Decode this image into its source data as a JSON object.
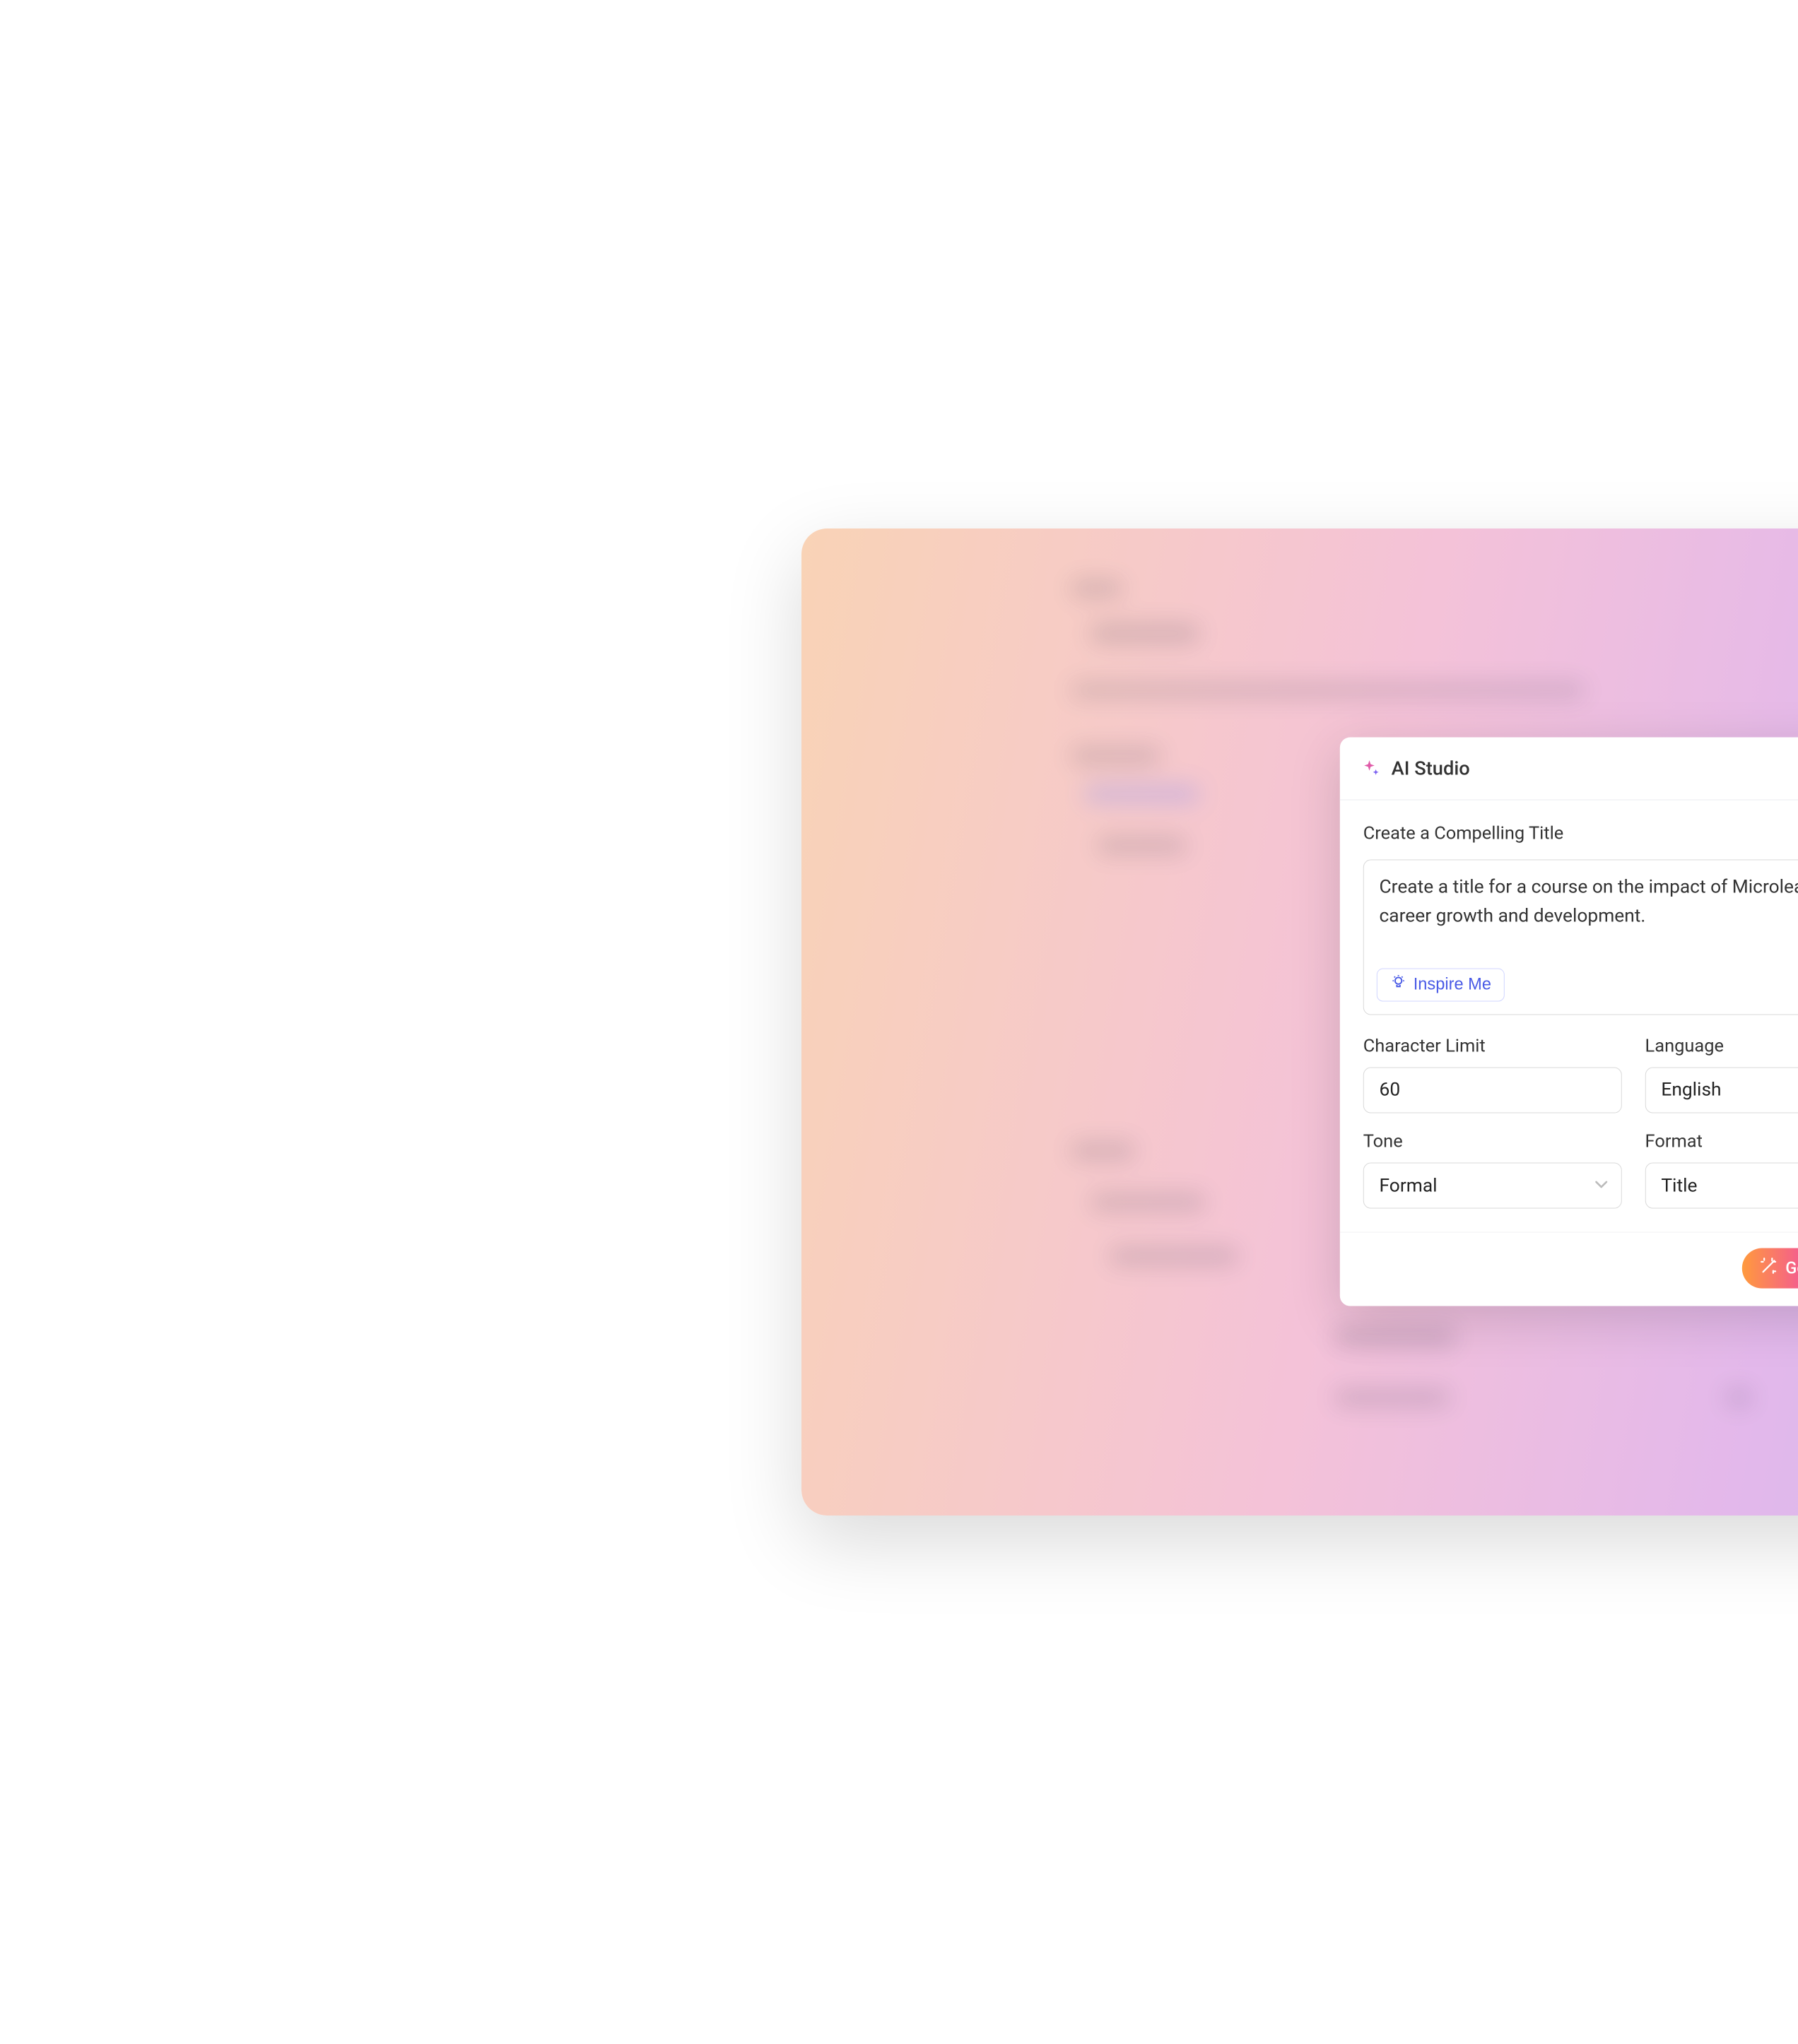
{
  "modal": {
    "title": "AI Studio",
    "section_label": "Create a Compelling Title",
    "prompt_text": "Create a title for a course on the impact of Microlearning on career growth and development.",
    "inspire_label": "Inspire Me",
    "fields": {
      "char_limit": {
        "label": "Character Limit",
        "value": "60"
      },
      "language": {
        "label": "Language",
        "value": "English"
      },
      "tone": {
        "label": "Tone",
        "value": "Formal"
      },
      "format": {
        "label": "Format",
        "value": "Title"
      }
    },
    "generate_label": "Generate Now"
  }
}
